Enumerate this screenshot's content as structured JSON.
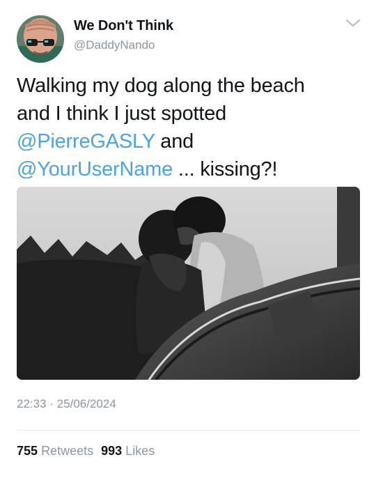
{
  "author": {
    "display_name": "We Don't Think",
    "handle": "@DaddyNando"
  },
  "tweet": {
    "lines": [
      [
        {
          "text": "Walking my dog along the beach",
          "type": "text"
        }
      ],
      [
        {
          "text": "and I think I just spotted",
          "type": "text"
        }
      ],
      [
        {
          "text": "@PierreGASLY",
          "type": "mention"
        },
        {
          "text": " and",
          "type": "text"
        }
      ],
      [
        {
          "text": "@YourUserName",
          "type": "mention"
        },
        {
          "text": " ... kissing?!",
          "type": "text"
        }
      ]
    ]
  },
  "meta": {
    "time": "22:33",
    "separator": "·",
    "date": "25/06/2024"
  },
  "stats": {
    "retweets_count": "755",
    "retweets_label": "Retweets",
    "likes_count": "993",
    "likes_label": "Likes"
  },
  "icons": {
    "menu": "chevron-down-icon"
  },
  "colors": {
    "mention": "#4aa3ea",
    "secondary_text": "#8a96a3",
    "primary_text": "#0f1419",
    "divider": "#dfe3e7"
  }
}
